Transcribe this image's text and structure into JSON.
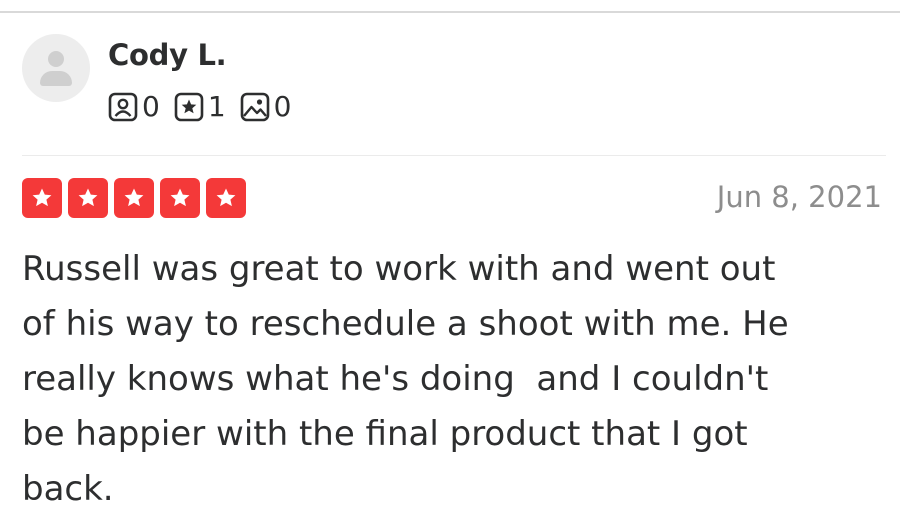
{
  "review": {
    "user": {
      "name": "Cody L.",
      "avatar_icon": "default-user-avatar",
      "stats": {
        "friends": {
          "icon": "friends-icon",
          "count": "0"
        },
        "reviews": {
          "icon": "review-star-icon",
          "count": "1"
        },
        "photos": {
          "icon": "photo-icon",
          "count": "0"
        }
      }
    },
    "rating": 5,
    "rating_max": 5,
    "star_color": "#f43939",
    "date": "Jun 8, 2021",
    "text": "Russell was great to work with and went out\nof his way to reschedule a shoot with me. He\nreally knows what he's doing  and I couldn't\nbe happier with the final product that I got\nback."
  }
}
